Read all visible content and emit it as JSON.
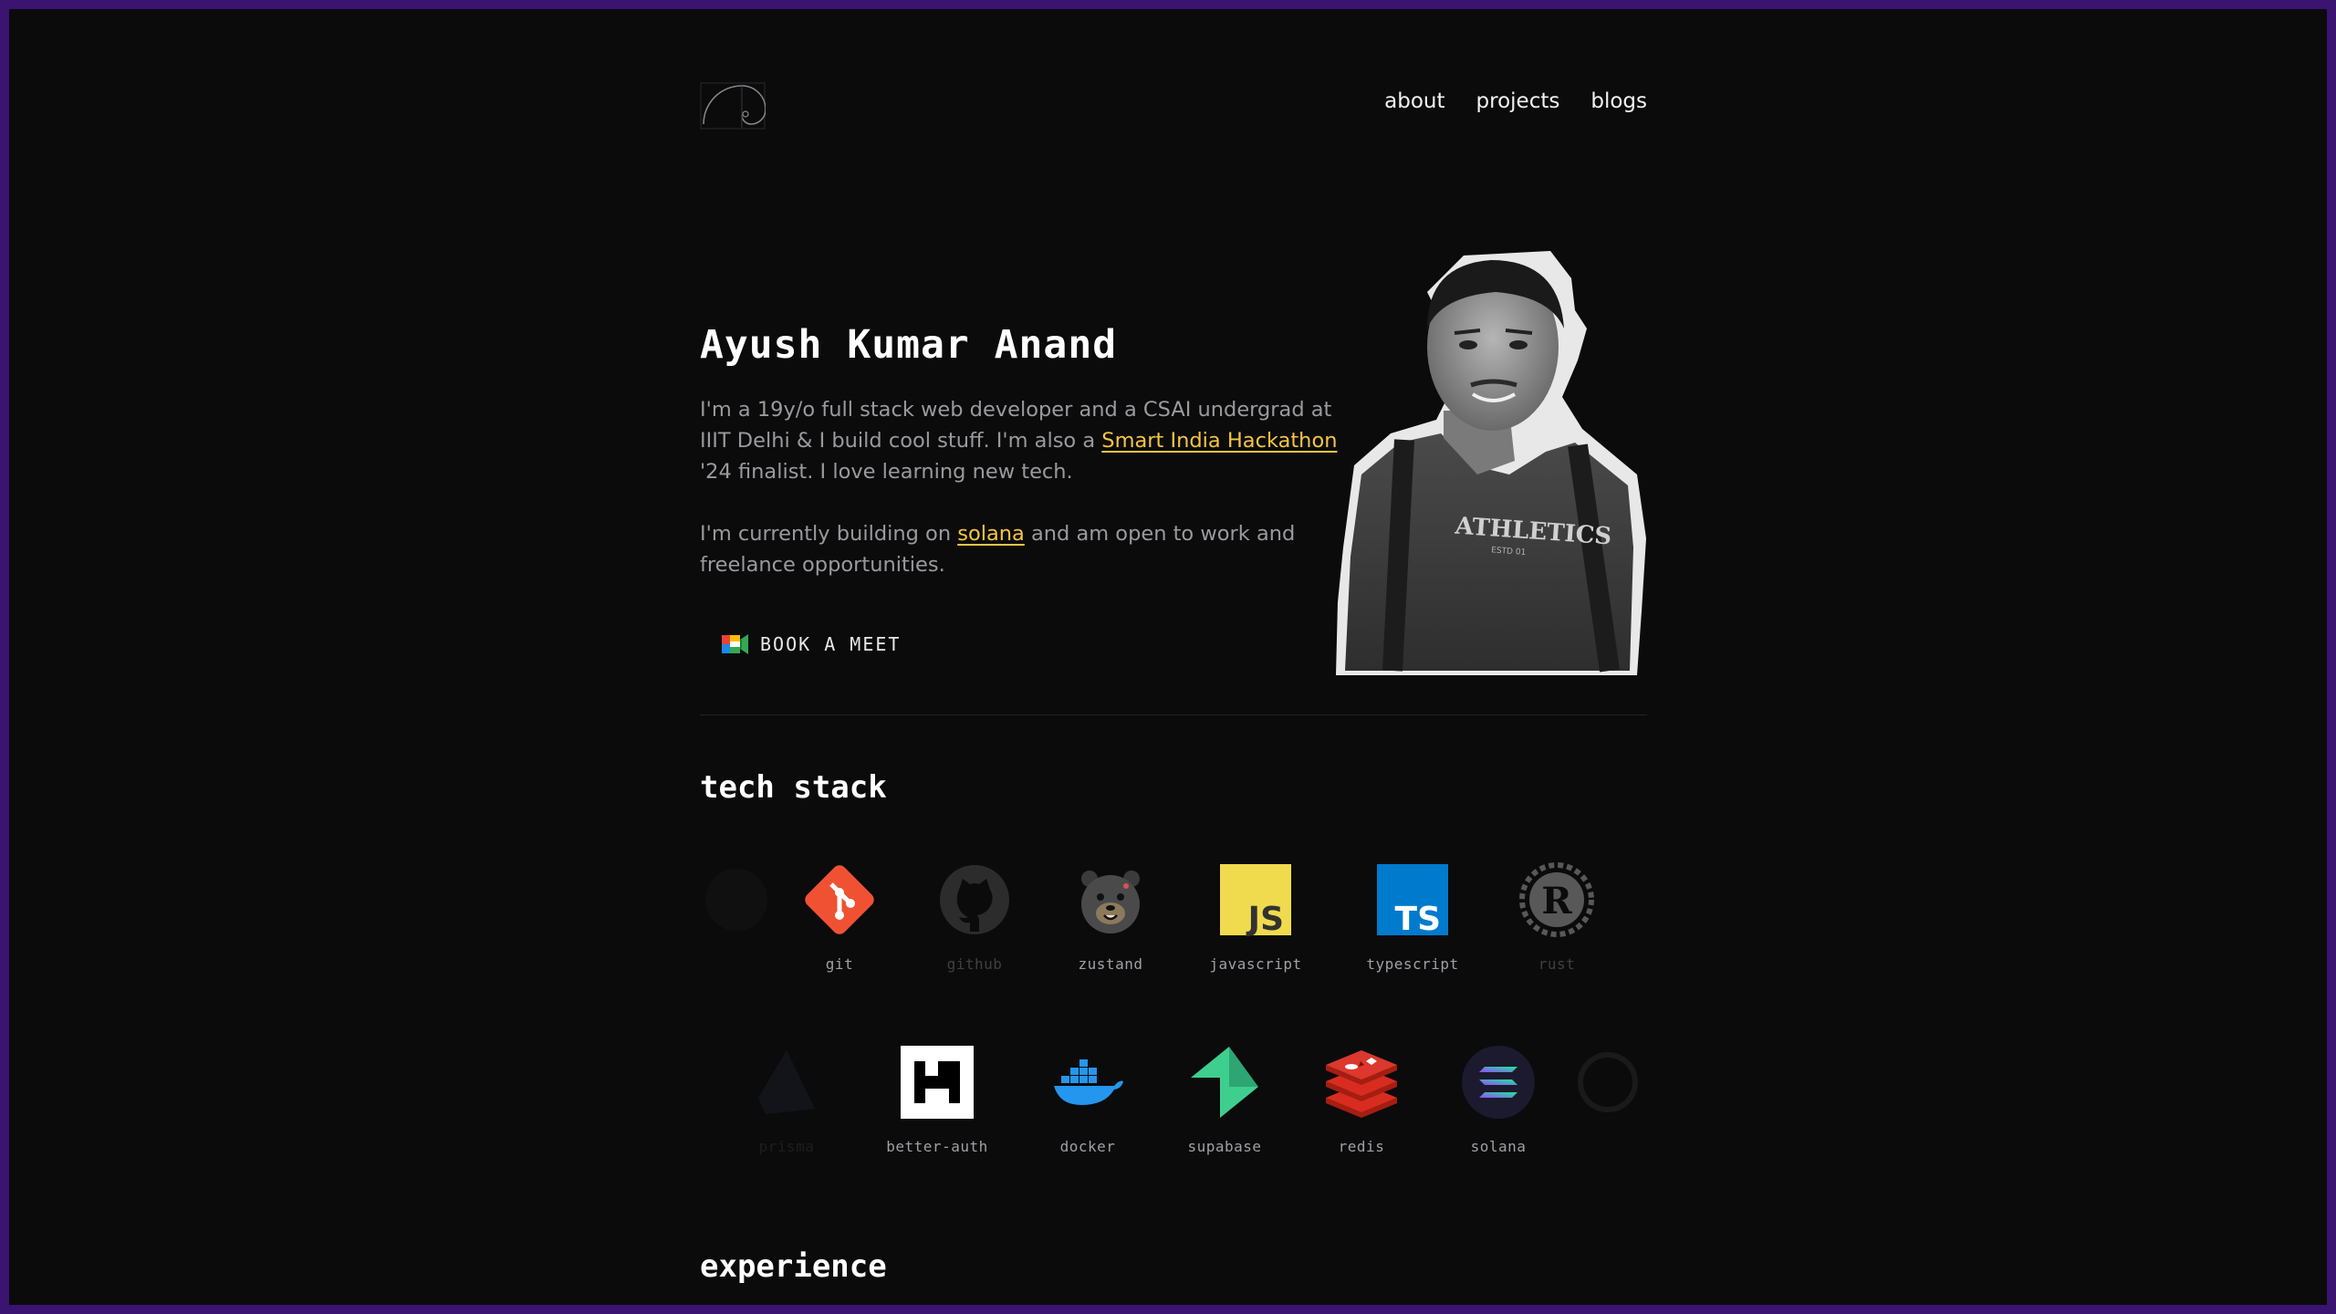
{
  "nav": {
    "items": [
      {
        "label": "about"
      },
      {
        "label": "projects"
      },
      {
        "label": "blogs"
      }
    ]
  },
  "hero": {
    "name": "Ayush Kumar Anand",
    "bio1_pre": "I'm a 19y/o full stack web developer and a CSAI undergrad at IIIT Delhi & I build cool stuff. I'm also a ",
    "bio1_link": "Smart India Hackathon",
    "bio1_post": " '24 finalist. I love learning new tech.",
    "bio2_pre": "I'm currently building on ",
    "bio2_link": "solana",
    "bio2_post": " and am open to work and freelance opportunities.",
    "cta_label": "BOOK A MEET"
  },
  "tech_stack": {
    "title": "tech stack",
    "row1": [
      "git",
      "github",
      "zustand",
      "javascript",
      "typescript",
      "rust"
    ],
    "row2": [
      "prisma",
      "better-auth",
      "docker",
      "supabase",
      "redis",
      "solana"
    ]
  },
  "experience": {
    "title": "experience"
  },
  "colors": {
    "accent_link": "#f5c542",
    "background": "#0b0b0c",
    "border": "#3a1470"
  }
}
